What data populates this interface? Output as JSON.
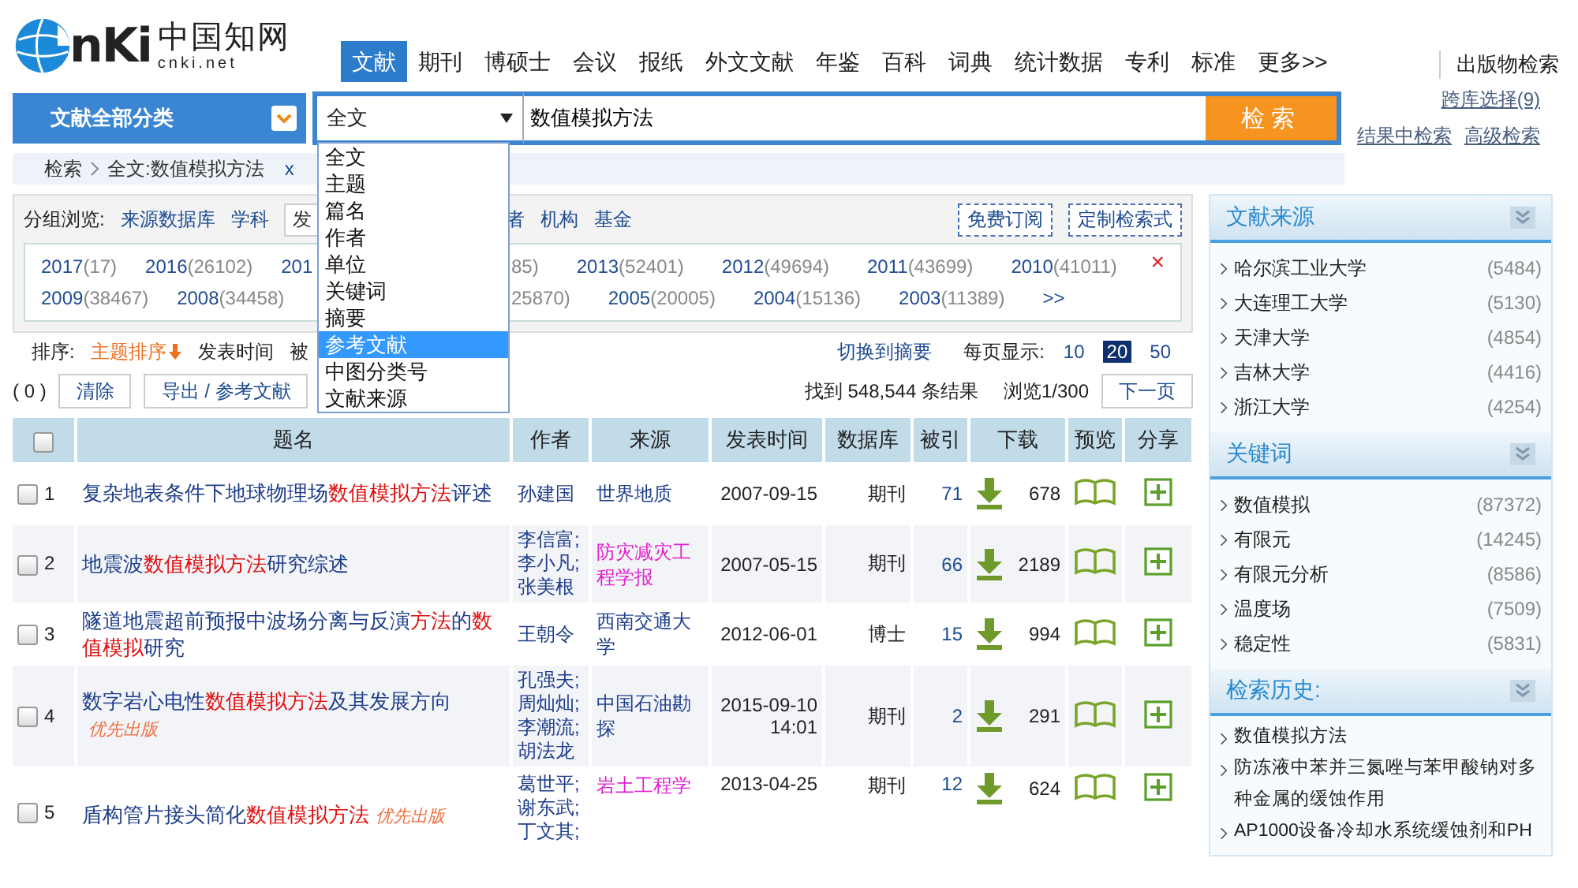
{
  "logo": {
    "wordmark": "nKi",
    "name": "中国知网",
    "domain": "cnki.net"
  },
  "nav": [
    {
      "label": "文献",
      "selected": true
    },
    {
      "label": "期刊",
      "selected": false
    },
    {
      "label": "博硕士",
      "selected": false
    },
    {
      "label": "会议",
      "selected": false
    },
    {
      "label": "报纸",
      "selected": false
    },
    {
      "label": "外文文献",
      "selected": false
    },
    {
      "label": "年鉴",
      "selected": false
    },
    {
      "label": "百科",
      "selected": false
    },
    {
      "label": "词典",
      "selected": false
    },
    {
      "label": "统计数据",
      "selected": false
    },
    {
      "label": "专利",
      "selected": false
    },
    {
      "label": "标准",
      "selected": false
    },
    {
      "label": "更多>>",
      "selected": false
    }
  ],
  "publication_search": "出版物检索",
  "category_button": "文献全部分类",
  "search": {
    "field": "全文",
    "value": "数值模拟方法",
    "button": "检索"
  },
  "field_dropdown": [
    {
      "label": "全文",
      "selected": false
    },
    {
      "label": "主题",
      "selected": false
    },
    {
      "label": "篇名",
      "selected": false
    },
    {
      "label": "作者",
      "selected": false
    },
    {
      "label": "单位",
      "selected": false
    },
    {
      "label": "关键词",
      "selected": false
    },
    {
      "label": "摘要",
      "selected": false
    },
    {
      "label": "参考文献",
      "selected": true
    },
    {
      "label": "中图分类号",
      "selected": false
    },
    {
      "label": "文献来源",
      "selected": false
    }
  ],
  "cross_db": "跨库选择(9)",
  "search_links": [
    "结果中检索",
    "高级检索"
  ],
  "breadcrumb": {
    "root": "检索",
    "current": "全文:数值模拟方法",
    "remove": "x"
  },
  "group_browse": {
    "label": "分组浏览:",
    "groups": [
      {
        "label": "来源数据库",
        "selected": false
      },
      {
        "label": "学科",
        "selected": false
      },
      {
        "label": "发",
        "selected": true
      },
      {
        "label": "者",
        "selected": false
      },
      {
        "label": "机构",
        "selected": false
      },
      {
        "label": "基金",
        "selected": false
      }
    ],
    "actions": [
      "免费订阅",
      "定制检索式"
    ],
    "year_rows": [
      [
        {
          "kind": "year",
          "year": "2017",
          "count": "(17)"
        },
        {
          "kind": "year",
          "year": "2016",
          "count": "(26102)"
        },
        {
          "kind": "cut_right",
          "year": "201"
        },
        {
          "kind": "cut_left",
          "count": "85)"
        },
        {
          "kind": "year",
          "year": "2013",
          "count": "(52401)"
        },
        {
          "kind": "year",
          "year": "2012",
          "count": "(49694)"
        },
        {
          "kind": "year",
          "year": "2011",
          "count": "(43699)"
        },
        {
          "kind": "year",
          "year": "2010",
          "count": "(41011)"
        }
      ],
      [
        {
          "kind": "year",
          "year": "2009",
          "count": "(38467)"
        },
        {
          "kind": "year",
          "year": "2008",
          "count": "(34458)"
        },
        {
          "kind": "cut_left",
          "count": "25870)"
        },
        {
          "kind": "year",
          "year": "2005",
          "count": "(20005)"
        },
        {
          "kind": "year",
          "year": "2004",
          "count": "(15136)"
        },
        {
          "kind": "year",
          "year": "2003",
          "count": "(11389)"
        },
        {
          "kind": "year",
          "year": ">>"
        }
      ]
    ],
    "close": "×"
  },
  "sort": {
    "label": "排序:",
    "options": [
      {
        "label": "主题排序",
        "selected": true
      },
      {
        "label": "发表时间",
        "selected": false
      },
      {
        "label": "被",
        "selected": false
      }
    ],
    "switch": "切换到摘要",
    "per_page_label": "每页显示:",
    "per_page": [
      {
        "label": "10",
        "selected": false
      },
      {
        "label": "20",
        "selected": true
      },
      {
        "label": "50",
        "selected": false
      }
    ]
  },
  "actions": {
    "count": "( 0 )",
    "clear": "清除",
    "export": "导出 / 参考文献",
    "found": "找到 548,544 条结果",
    "page": "浏览1/300",
    "next": "下一页"
  },
  "table": {
    "header_checked": false,
    "columns": [
      "题名",
      "作者",
      "来源",
      "发表时间",
      "数据库",
      "被引",
      "下载",
      "预览",
      "分享"
    ],
    "rows": [
      {
        "no": "1",
        "checked": false,
        "title": [
          {
            "text": "复杂地表条件下地球物理场",
            "hl": false
          },
          {
            "text": "数值模拟方法",
            "hl": true
          },
          {
            "text": "评述",
            "hl": false
          }
        ],
        "authors": [
          "孙建国"
        ],
        "source": {
          "text": "世界地质",
          "color": "#1f3f8f"
        },
        "date": "2007-09-15",
        "db": "期刊",
        "cited": "71",
        "downloads": "678"
      },
      {
        "no": "2",
        "checked": false,
        "title": [
          {
            "text": "地震波",
            "hl": false
          },
          {
            "text": "数值模拟方法",
            "hl": true
          },
          {
            "text": "研究综述",
            "hl": false
          }
        ],
        "authors": [
          "李信富;",
          "李小凡;",
          "张美根"
        ],
        "source": {
          "text": "防灾减灾工程学报",
          "color": "#e020d0"
        },
        "date": "2007-05-15",
        "db": "期刊",
        "cited": "66",
        "downloads": "2189"
      },
      {
        "no": "3",
        "checked": false,
        "title": [
          {
            "text": "隧道地震超前预报中波场分离与反演",
            "hl": false
          },
          {
            "text": "方法",
            "hl": true
          },
          {
            "text": "的",
            "hl": false
          },
          {
            "text": "数值模拟",
            "hl": true
          },
          {
            "text": "研究",
            "hl": false
          }
        ],
        "authors": [
          "王朝令"
        ],
        "source": {
          "text": "西南交通大学",
          "color": "#1f3f8f"
        },
        "date": "2012-06-01",
        "db": "博士",
        "cited": "15",
        "downloads": "994"
      },
      {
        "no": "4",
        "checked": false,
        "title": [
          {
            "text": "数字岩心电性",
            "hl": false
          },
          {
            "text": "数值模拟方法",
            "hl": true
          },
          {
            "text": "及其发展方向",
            "hl": false
          }
        ],
        "tag": "优先出版",
        "authors": [
          "孔强夫;",
          "周灿灿;",
          "李潮流;",
          "胡法龙"
        ],
        "source": {
          "text": "中国石油勘探",
          "color": "#1f3f8f"
        },
        "date": "2015-09-10 14:01",
        "db": "期刊",
        "cited": "2",
        "downloads": "291"
      },
      {
        "no": "5",
        "checked": false,
        "title": [
          {
            "text": "盾构管片接头简化",
            "hl": false
          },
          {
            "text": "数值模拟方法",
            "hl": true
          }
        ],
        "tag": "优先出版",
        "authors": [
          "葛世平;",
          "谢东武;",
          "丁文其;"
        ],
        "source": {
          "text": "岩土工程学",
          "color": "#e020d0"
        },
        "date": "2013-04-25",
        "db": "期刊",
        "cited": "12",
        "downloads": "624"
      }
    ]
  },
  "sidebar": [
    {
      "kind": "facet",
      "title": "文献来源",
      "items": [
        {
          "label": "哈尔滨工业大学",
          "count": "(5484)"
        },
        {
          "label": "大连理工大学",
          "count": "(5130)"
        },
        {
          "label": "天津大学",
          "count": "(4854)"
        },
        {
          "label": "吉林大学",
          "count": "(4416)"
        },
        {
          "label": "浙江大学",
          "count": "(4254)"
        }
      ]
    },
    {
      "kind": "facet",
      "title": "关键词",
      "items": [
        {
          "label": "数值模拟",
          "count": "(87372)"
        },
        {
          "label": "有限元",
          "count": "(14245)"
        },
        {
          "label": "有限元分析",
          "count": "(8586)"
        },
        {
          "label": "温度场",
          "count": "(7509)"
        },
        {
          "label": "稳定性",
          "count": "(5831)"
        }
      ]
    },
    {
      "kind": "history",
      "title": "检索历史:",
      "items": [
        {
          "label": "数值模拟方法"
        },
        {
          "label": "防冻液中苯并三氮唑与苯甲酸钠对多种金属的缓蚀作用"
        },
        {
          "label": "AP1000设备冷却水系统缓蚀剂和PH"
        }
      ]
    }
  ]
}
